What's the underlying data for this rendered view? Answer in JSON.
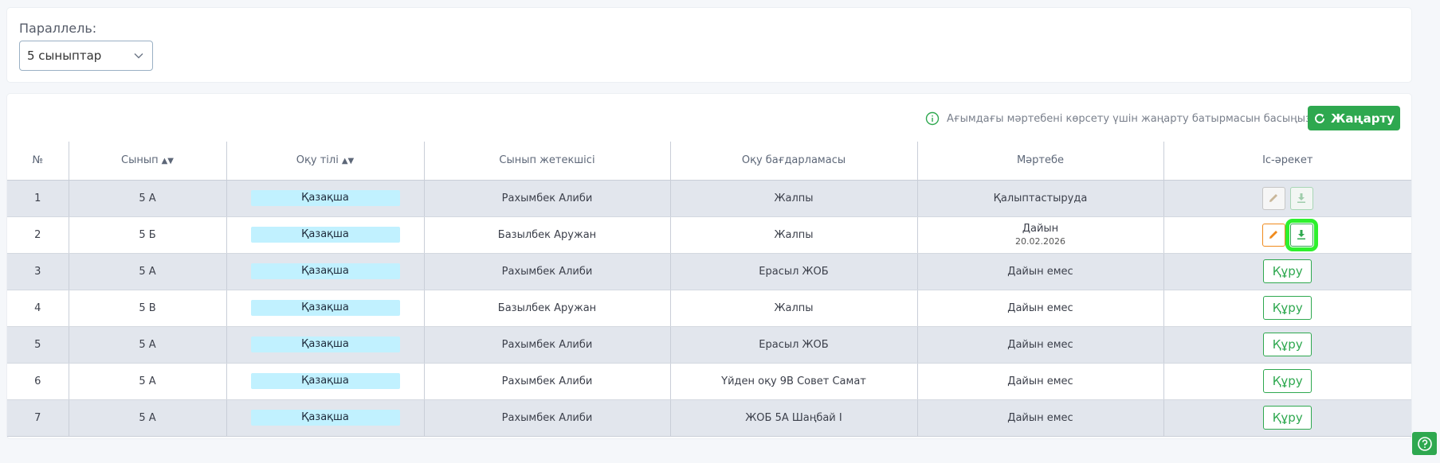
{
  "filter": {
    "label": "Параллель:",
    "selected": "5 сыныптар"
  },
  "toolbar": {
    "hint": "Ағымдағы мәртебені көрсету үшін жаңарту батырмасын басыңыз",
    "refresh_label": "Жаңарту"
  },
  "table": {
    "headers": [
      "№",
      "Сынып",
      "Оқу тілі",
      "Сынып жетекшісі",
      "Оқу бағдарламасы",
      "Мәртебе",
      "Іс-әрекет"
    ],
    "rows": [
      {
        "num": "1",
        "class": "5 А",
        "lang": "Қазақша",
        "teacher": "Рахымбек Алиби",
        "program": "Жалпы",
        "status": "Қалыптастыруда",
        "date": "",
        "action": "icons-disabled"
      },
      {
        "num": "2",
        "class": "5 Б",
        "lang": "Қазақша",
        "teacher": "Базылбек Аружан",
        "program": "Жалпы",
        "status": "Дайын",
        "date": "20.02.2026",
        "action": "icons-active"
      },
      {
        "num": "3",
        "class": "5 А",
        "lang": "Қазақша",
        "teacher": "Рахымбек Алиби",
        "program": "Ерасыл ЖОБ",
        "status": "Дайын емес",
        "date": "",
        "action": "create"
      },
      {
        "num": "4",
        "class": "5 В",
        "lang": "Қазақша",
        "teacher": "Базылбек Аружан",
        "program": "Жалпы",
        "status": "Дайын емес",
        "date": "",
        "action": "create"
      },
      {
        "num": "5",
        "class": "5 А",
        "lang": "Қазақша",
        "teacher": "Рахымбек Алиби",
        "program": "Ерасыл ЖОБ",
        "status": "Дайын емес",
        "date": "",
        "action": "create"
      },
      {
        "num": "6",
        "class": "5 А",
        "lang": "Қазақша",
        "teacher": "Рахымбек Алиби",
        "program": "Үйден оқу 9В Совет Самат",
        "status": "Дайын емес",
        "date": "",
        "action": "create"
      },
      {
        "num": "7",
        "class": "5 А",
        "lang": "Қазақша",
        "teacher": "Рахымбек Алиби",
        "program": "ЖОБ 5А Шаңбай І",
        "status": "Дайын емес",
        "date": "",
        "action": "create"
      }
    ],
    "create_label": "Құру"
  },
  "icons": {
    "chevron": "chevron-down-icon",
    "info": "info-icon",
    "refresh": "refresh-icon",
    "edit": "pencil-icon",
    "download": "download-icon",
    "help": "help-icon"
  },
  "colors": {
    "accent_green": "#2ea84f",
    "edit_orange": "#f08a1c",
    "badge_bg": "#c1f1ff",
    "row_shade": "#e2e6ed",
    "highlight": "#2ef02e"
  }
}
